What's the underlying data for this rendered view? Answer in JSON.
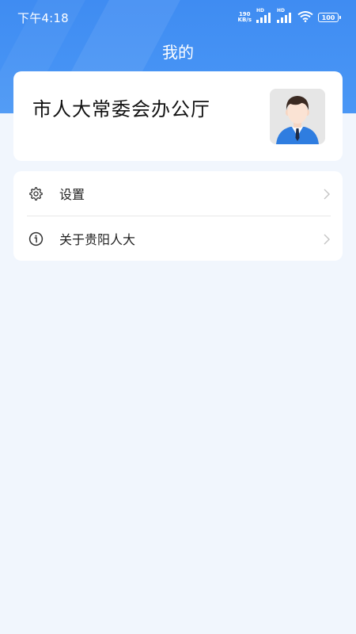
{
  "status_bar": {
    "time": "下午4:18",
    "net_speed_value": "190",
    "net_speed_unit": "KB/s",
    "hd_label_1": "HD",
    "hd_label_2": "HD",
    "battery": "100"
  },
  "header": {
    "title": "我的",
    "color": "#3f8cf2"
  },
  "profile": {
    "org_name": "市人大常委会办公厅",
    "avatar_icon": "user-avatar-icon"
  },
  "menu": {
    "items": [
      {
        "label": "设置",
        "icon": "gear-icon"
      },
      {
        "label": "关于贵阳人大",
        "icon": "info-icon"
      }
    ]
  }
}
